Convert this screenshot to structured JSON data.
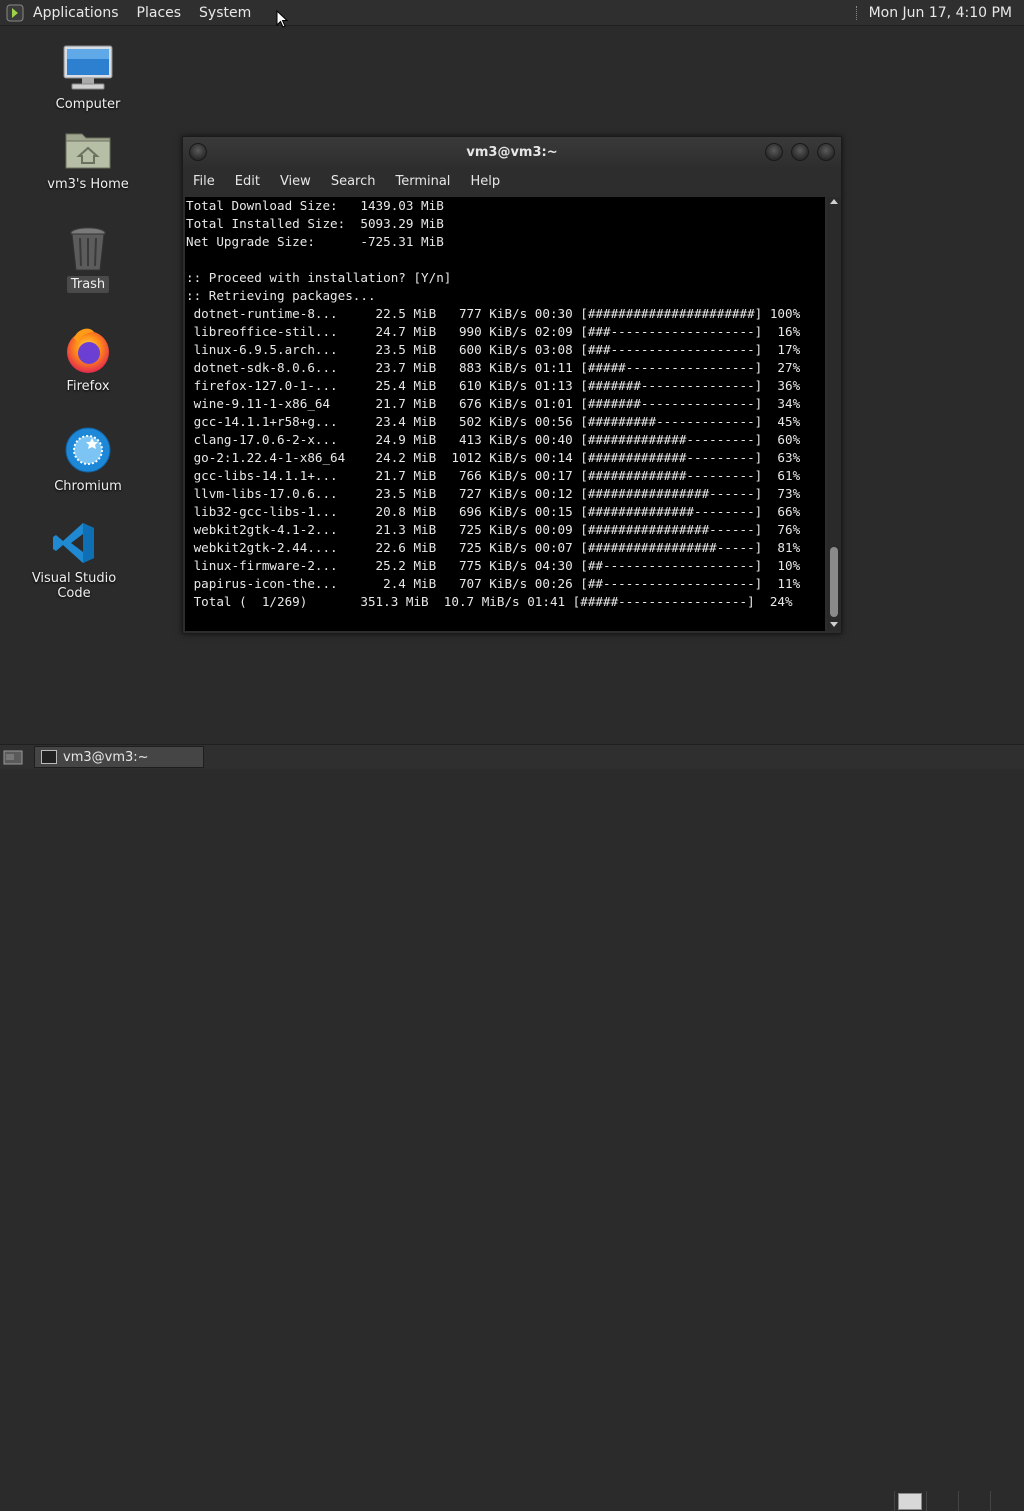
{
  "top_panel": {
    "menus": [
      "Applications",
      "Places",
      "System"
    ],
    "clock": "Mon Jun 17,  4:10 PM"
  },
  "desktop_icons": [
    {
      "label": "Computer",
      "icon": "computer-icon"
    },
    {
      "label": "vm3's Home",
      "icon": "home-folder-icon"
    },
    {
      "label": "Trash",
      "icon": "trash-icon"
    },
    {
      "label": "Firefox",
      "icon": "firefox-icon"
    },
    {
      "label": "Chromium",
      "icon": "chromium-icon"
    },
    {
      "label": "Visual Studio Code",
      "icon": "vscode-icon"
    }
  ],
  "terminal": {
    "title": "vm3@vm3:~",
    "menu": [
      "File",
      "Edit",
      "View",
      "Search",
      "Terminal",
      "Help"
    ],
    "lines": [
      "Total Download Size:   1439.03 MiB",
      "Total Installed Size:  5093.29 MiB",
      "Net Upgrade Size:      -725.31 MiB",
      "",
      ":: Proceed with installation? [Y/n]",
      ":: Retrieving packages...",
      " dotnet-runtime-8...     22.5 MiB   777 KiB/s 00:30 [######################] 100%",
      " libreoffice-stil...     24.7 MiB   990 KiB/s 02:09 [###-------------------]  16%",
      " linux-6.9.5.arch...     23.5 MiB   600 KiB/s 03:08 [###-------------------]  17%",
      " dotnet-sdk-8.0.6...     23.7 MiB   883 KiB/s 01:11 [#####-----------------]  27%",
      " firefox-127.0-1-...     25.4 MiB   610 KiB/s 01:13 [#######---------------]  36%",
      " wine-9.11-1-x86_64      21.7 MiB   676 KiB/s 01:01 [#######---------------]  34%",
      " gcc-14.1.1+r58+g...     23.4 MiB   502 KiB/s 00:56 [#########-------------]  45%",
      " clang-17.0.6-2-x...     24.9 MiB   413 KiB/s 00:40 [#############---------]  60%",
      " go-2:1.22.4-1-x86_64    24.2 MiB  1012 KiB/s 00:14 [#############---------]  63%",
      " gcc-libs-14.1.1+...     21.7 MiB   766 KiB/s 00:17 [#############---------]  61%",
      " llvm-libs-17.0.6...     23.5 MiB   727 KiB/s 00:12 [################------]  73%",
      " lib32-gcc-libs-1...     20.8 MiB   696 KiB/s 00:15 [##############--------]  66%",
      " webkit2gtk-4.1-2...     21.3 MiB   725 KiB/s 00:09 [################------]  76%",
      " webkit2gtk-2.44....     22.6 MiB   725 KiB/s 00:07 [#################-----]  81%",
      " linux-firmware-2...     25.2 MiB   775 KiB/s 04:30 [##--------------------]  10%",
      " papirus-icon-the...      2.4 MiB   707 KiB/s 00:26 [##--------------------]  11%",
      " Total (  1/269)       351.3 MiB  10.7 MiB/s 01:41 [#####-----------------]  24%"
    ]
  },
  "taskbar": {
    "window_button": "vm3@vm3:~"
  }
}
